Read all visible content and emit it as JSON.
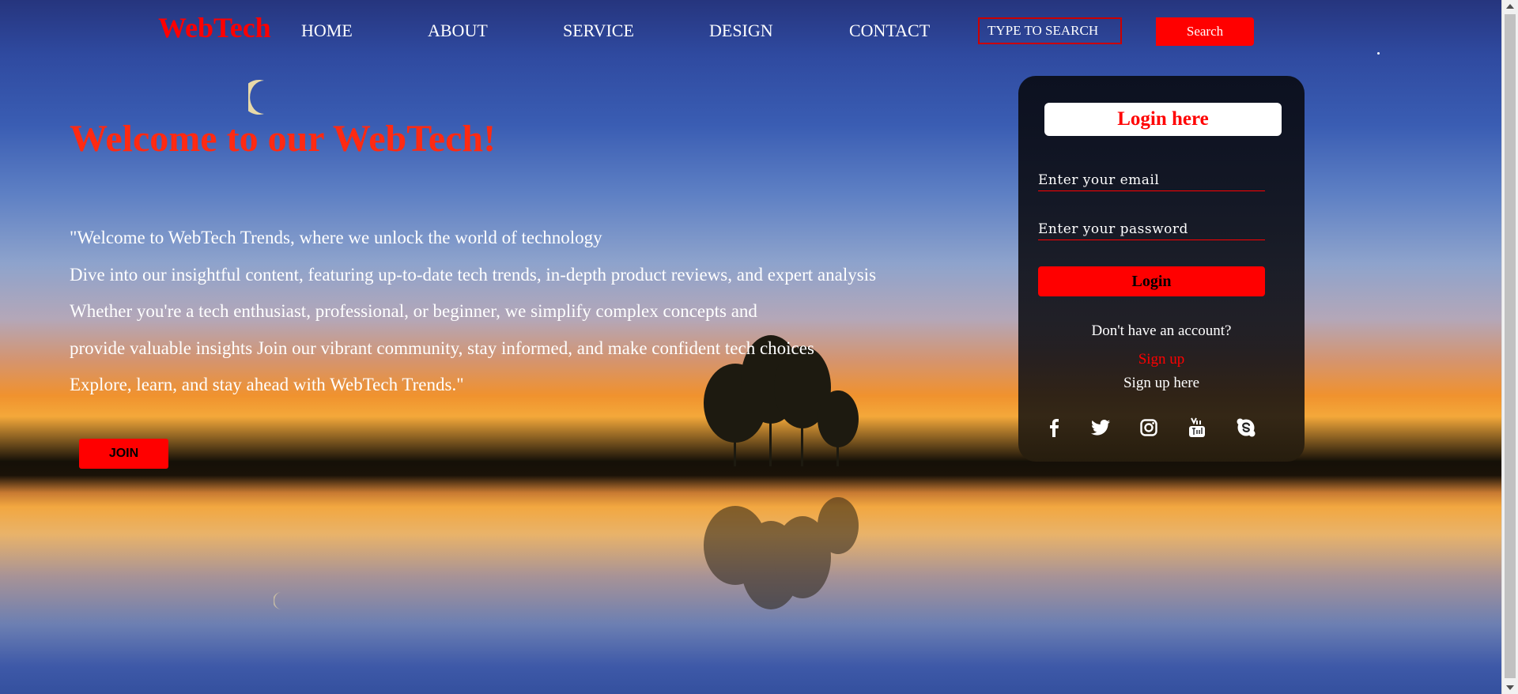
{
  "header": {
    "logo": "WebTech",
    "nav": [
      "HOME",
      "ABOUT",
      "SERVICE",
      "DESIGN",
      "CONTACT"
    ],
    "search_placeholder": "TYPE TO SEARCH",
    "search_button": "Search"
  },
  "hero": {
    "title": "Welcome to our WebTech!",
    "lines": [
      "\"Welcome to WebTech Trends, where we unlock the world of technology",
      "Dive into our insightful content, featuring up-to-date tech trends, in-depth product reviews, and expert analysis",
      "Whether you're a tech enthusiast, professional, or beginner, we simplify complex concepts and",
      "provide valuable insights Join our vibrant community, stay informed, and make confident tech choices",
      "Explore, learn, and stay ahead with WebTech Trends.\""
    ],
    "join_button": "JOIN"
  },
  "login": {
    "title": "Login here",
    "email_placeholder": "Enter your email",
    "password_placeholder": "Enter your password",
    "button": "Login",
    "no_account": "Don't have an account?",
    "signup_link": "Sign up",
    "signup_here": "Sign up here",
    "social_icons": [
      "facebook-icon",
      "twitter-icon",
      "instagram-icon",
      "youtube-icon",
      "skype-icon"
    ]
  },
  "colors": {
    "accent": "#ff0000",
    "card_bg": "#0d111c"
  }
}
